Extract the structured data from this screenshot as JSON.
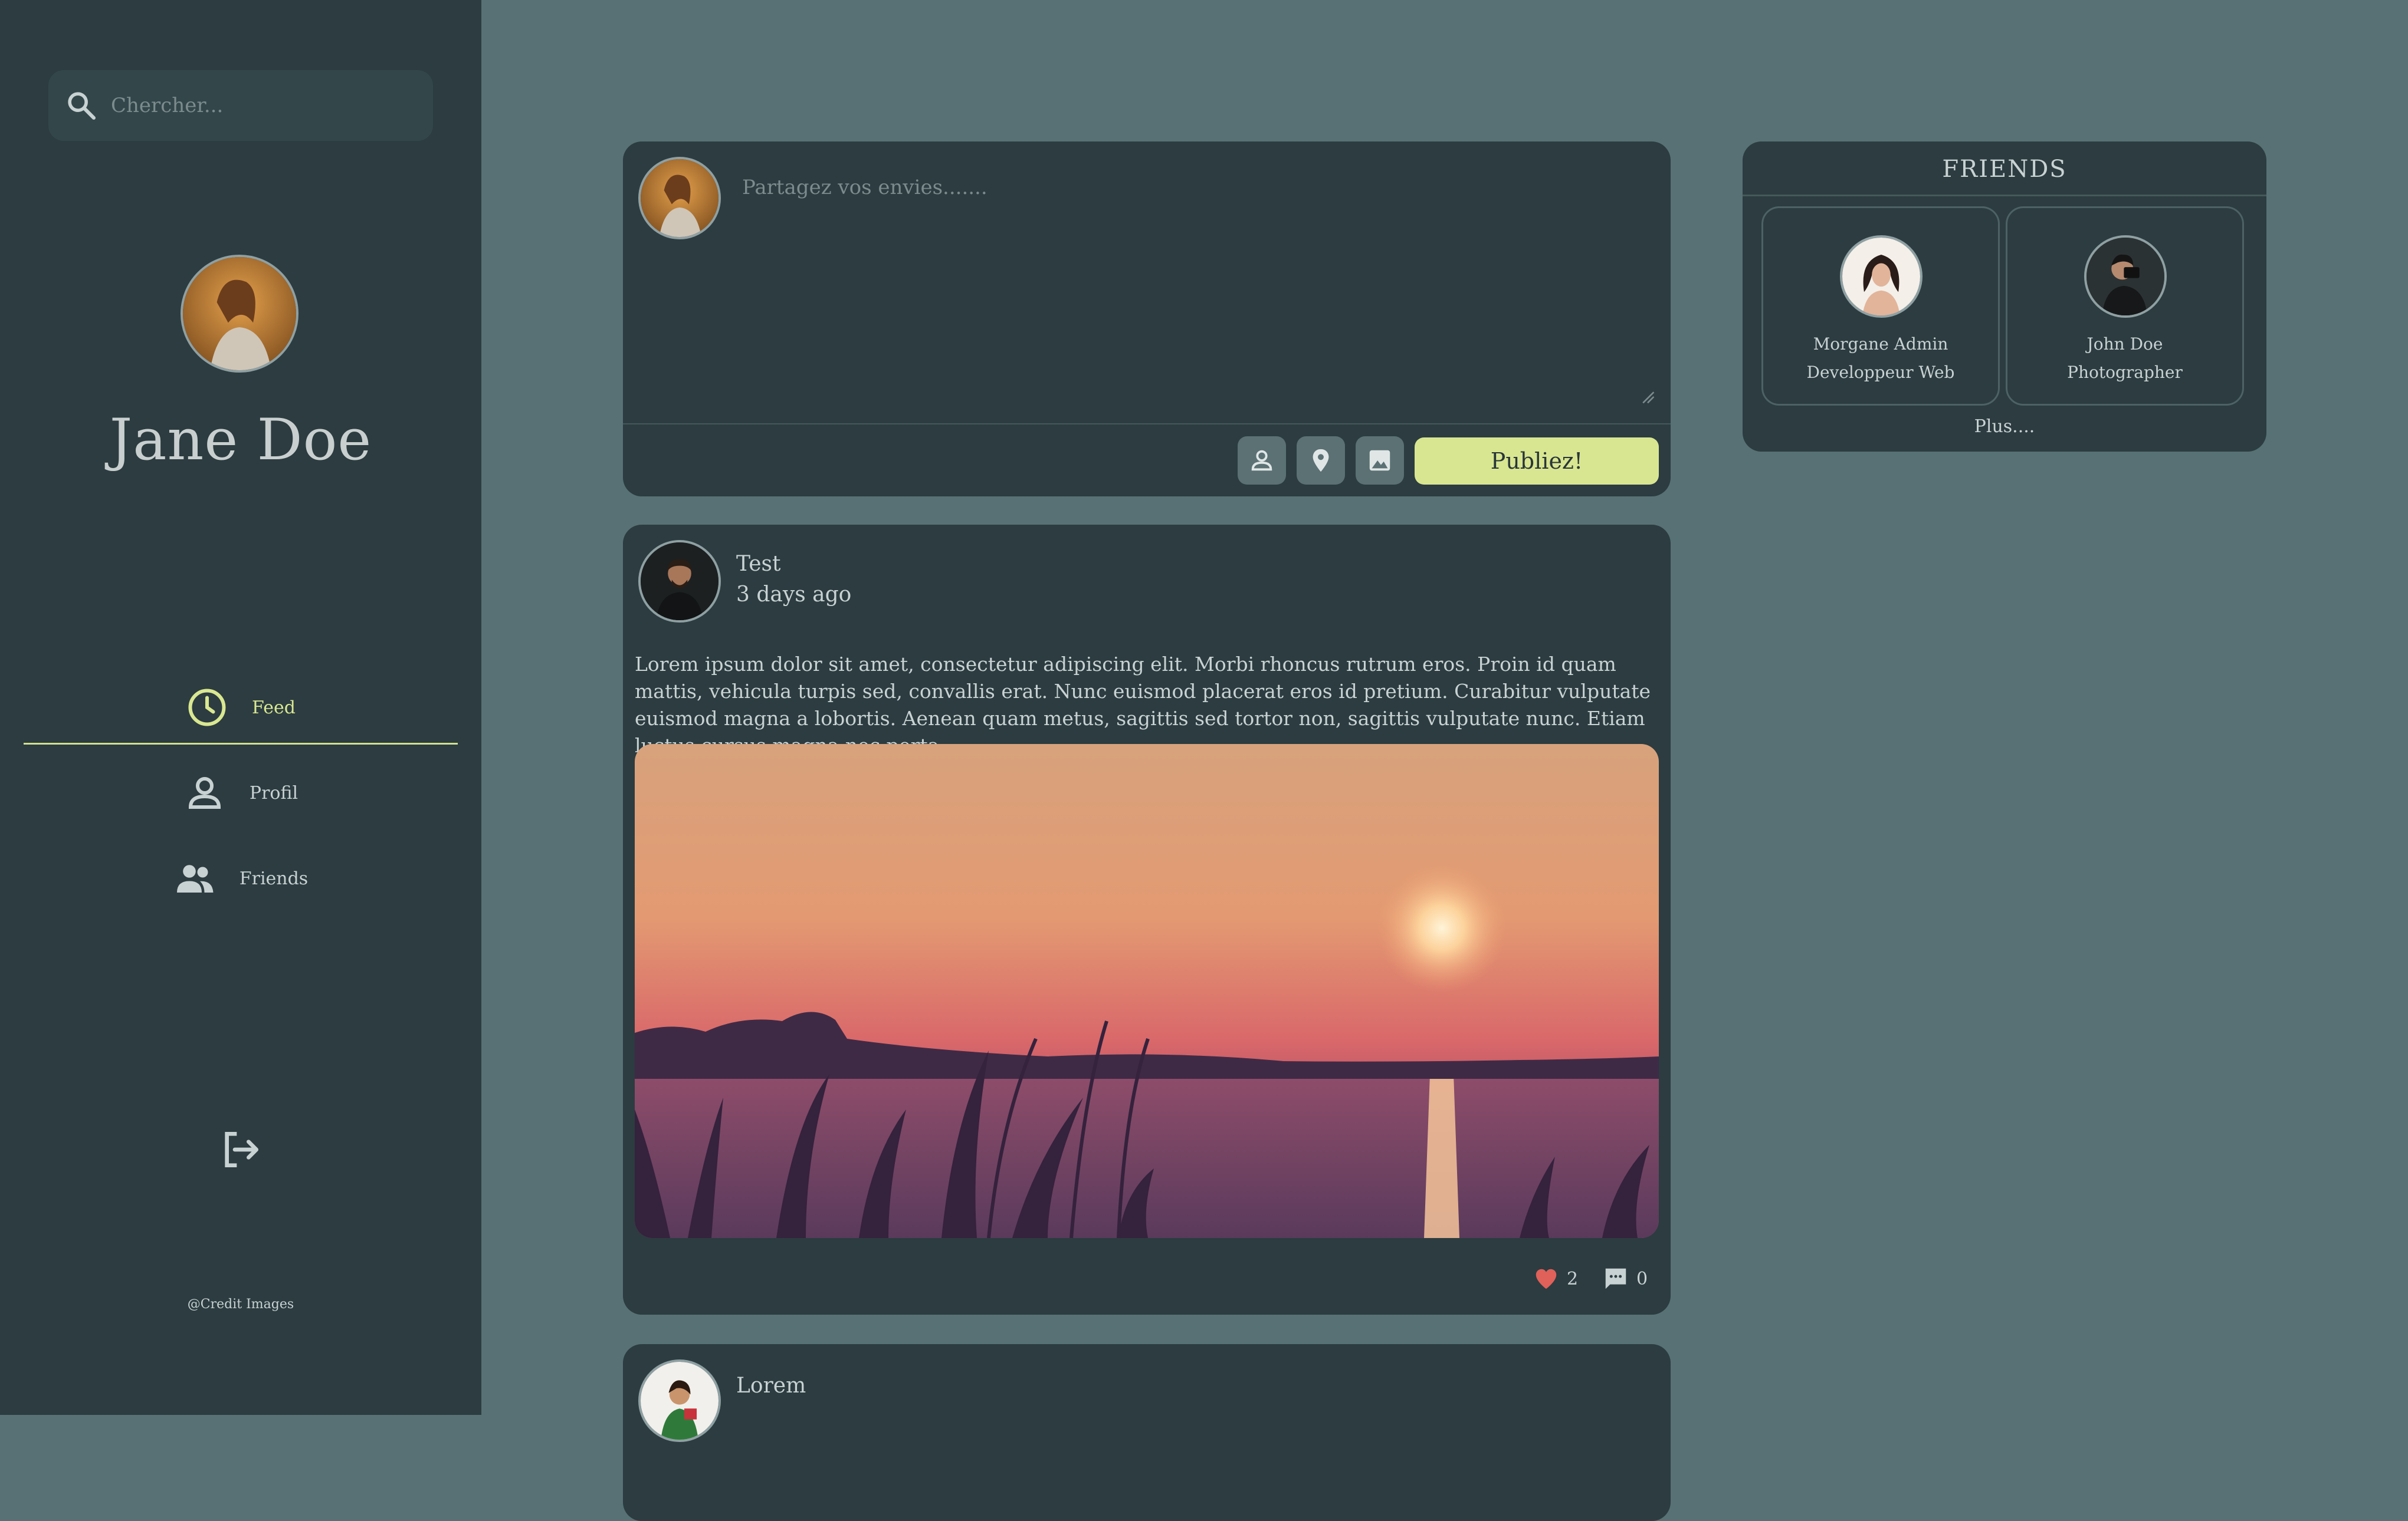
{
  "search": {
    "placeholder": "Chercher..."
  },
  "profile": {
    "name": "Jane Doe"
  },
  "nav": [
    {
      "label": "Feed",
      "icon": "clock-icon"
    },
    {
      "label": "Profil",
      "icon": "person-icon"
    },
    {
      "label": "Friends",
      "icon": "people-icon"
    }
  ],
  "sidebar_footer": {
    "credit": "@Credit Images"
  },
  "composer": {
    "placeholder": "Partagez vos envies.......",
    "publish_label": "Publiez!"
  },
  "posts": [
    {
      "author": "Test",
      "time": "3 days ago",
      "text": "Lorem ipsum dolor sit amet, consectetur adipiscing elit. Morbi rhoncus rutrum eros. Proin id quam mattis, vehicula turpis sed, convallis erat. Nunc euismod placerat eros id pretium. Curabitur vulputate euismod magna a lobortis. Aenean quam metus, sagittis sed tortor non, sagittis vulputate nunc. Etiam luctus cursus magna nec porta.",
      "likes": "2",
      "comments": "0"
    },
    {
      "author": "Lorem"
    }
  ],
  "friends": {
    "title": "FRIENDS",
    "items": [
      {
        "name": "Morgane Admin",
        "role": "Developpeur Web"
      },
      {
        "name": "John Doe",
        "role": "Photographer"
      }
    ],
    "more": "Plus...."
  },
  "colors": {
    "accent": "#d8e691",
    "background": "#577174",
    "panel": "#2c3c40",
    "like": "#e0605a"
  }
}
